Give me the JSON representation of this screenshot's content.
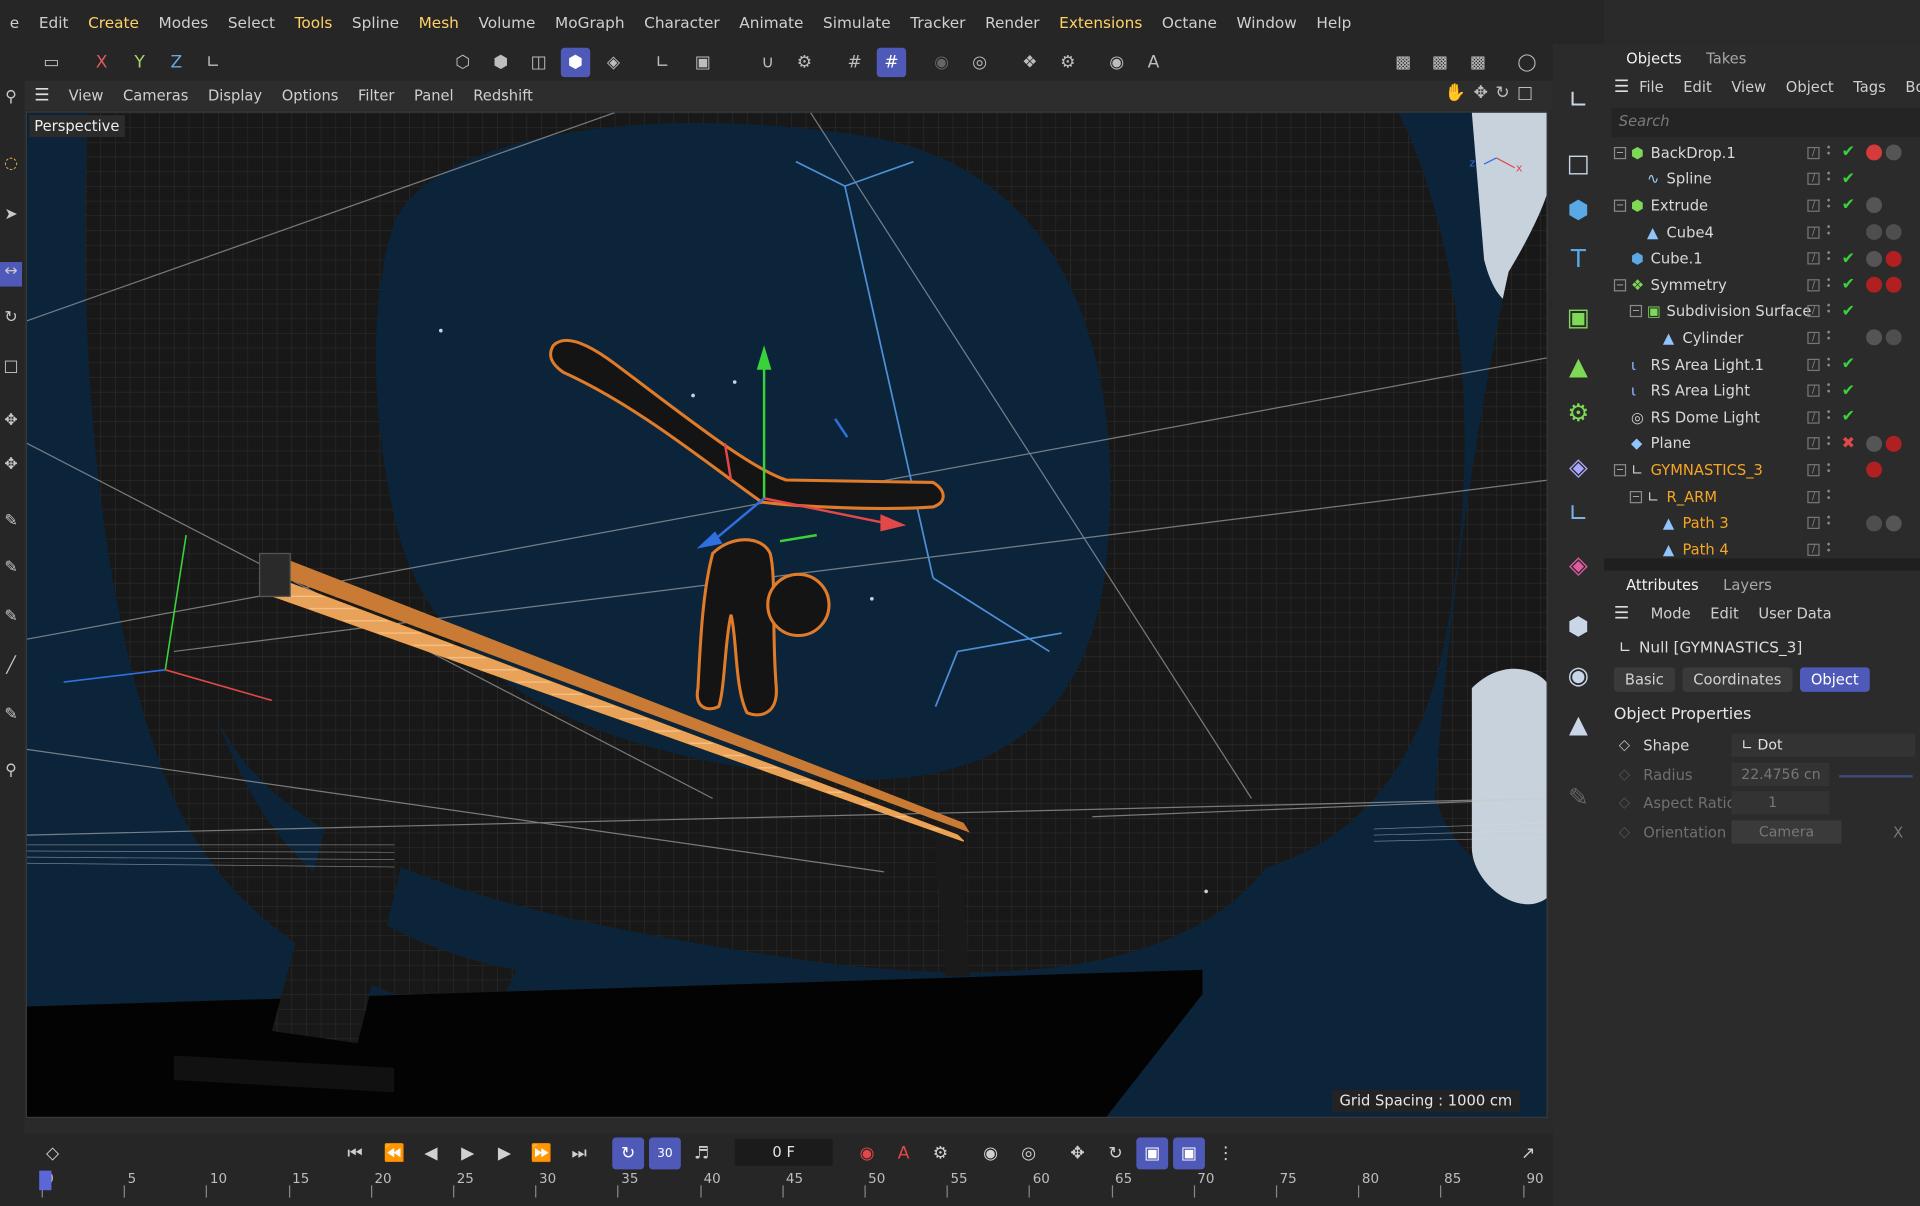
{
  "menubar": [
    "e",
    "Edit",
    "Create",
    "Modes",
    "Select",
    "Tools",
    "Spline",
    "Mesh",
    "Volume",
    "MoGraph",
    "Character",
    "Animate",
    "Simulate",
    "Tracker",
    "Render",
    "Extensions",
    "Octane",
    "Window",
    "Help"
  ],
  "highlighted_menus": [
    "Create",
    "Tools",
    "Mesh",
    "Extensions"
  ],
  "axis_buttons": {
    "x": "X",
    "y": "Y",
    "z": "Z"
  },
  "viewport_menu": [
    "View",
    "Cameras",
    "Display",
    "Options",
    "Filter",
    "Panel",
    "Redshift"
  ],
  "viewport": {
    "label": "Perspective",
    "grid_spacing": "Grid Spacing : 1000 cm",
    "bg_color": "#0c2439",
    "selection_color": "#f0a34a"
  },
  "objects_panel": {
    "tabs": [
      "Objects",
      "Takes"
    ],
    "menu": [
      "File",
      "Edit",
      "View",
      "Object",
      "Tags",
      "Book"
    ],
    "search_placeholder": "Search",
    "rows": [
      {
        "name": "BackDrop.1",
        "depth": 0,
        "icon": "cube-green",
        "expand": "-",
        "check": "check"
      },
      {
        "name": "Spline",
        "depth": 1,
        "icon": "spline",
        "expand": "",
        "check": "check"
      },
      {
        "name": "Extrude",
        "depth": 0,
        "icon": "cube-green",
        "expand": "-",
        "check": "check"
      },
      {
        "name": "Cube4",
        "depth": 1,
        "icon": "poly",
        "expand": "",
        "check": ""
      },
      {
        "name": "Cube.1",
        "depth": 0,
        "icon": "cube-blue",
        "expand": "",
        "check": "check"
      },
      {
        "name": "Symmetry",
        "depth": 0,
        "icon": "symmetry",
        "expand": "-",
        "check": "check"
      },
      {
        "name": "Subdivision Surface",
        "depth": 1,
        "icon": "subdiv",
        "expand": "-",
        "check": "check"
      },
      {
        "name": "Cylinder",
        "depth": 2,
        "icon": "poly",
        "expand": "",
        "check": ""
      },
      {
        "name": "RS Area Light.1",
        "depth": 0,
        "icon": "light",
        "expand": "",
        "check": "check"
      },
      {
        "name": "RS Area Light",
        "depth": 0,
        "icon": "light",
        "expand": "",
        "check": "check"
      },
      {
        "name": "RS Dome Light",
        "depth": 0,
        "icon": "dome",
        "expand": "",
        "check": "check"
      },
      {
        "name": "Plane",
        "depth": 0,
        "icon": "plane",
        "expand": "",
        "check": "x"
      },
      {
        "name": "GYMNASTICS_3",
        "depth": 0,
        "icon": "null",
        "expand": "-",
        "check": "",
        "orange": true
      },
      {
        "name": "R_ARM",
        "depth": 1,
        "icon": "null",
        "expand": "-",
        "check": "",
        "orange": true
      },
      {
        "name": "Path 3",
        "depth": 2,
        "icon": "poly",
        "expand": "",
        "check": "",
        "orange": true
      },
      {
        "name": "Path 4",
        "depth": 2,
        "icon": "poly",
        "expand": "",
        "check": "",
        "orange": true
      }
    ]
  },
  "attributes_panel": {
    "tabs": [
      "Attributes",
      "Layers"
    ],
    "menu": [
      "Mode",
      "Edit",
      "User Data"
    ],
    "object_name": "Null [GYMNASTICS_3]",
    "subtabs": [
      "Basic",
      "Coordinates",
      "Object"
    ],
    "active_subtab": "Object",
    "section": "Object Properties",
    "props": [
      {
        "label": "Shape",
        "value": "Dot",
        "enabled": true
      },
      {
        "label": "Radius",
        "value": "22.4756 cn",
        "enabled": false
      },
      {
        "label": "Aspect Ratio",
        "value": "1",
        "enabled": false
      },
      {
        "label": "Orientation",
        "value": "Camera",
        "enabled": false
      }
    ]
  },
  "timeline": {
    "frame": "0 F",
    "fps_label": "30",
    "ticks": [
      "0",
      "5",
      "10",
      "15",
      "20",
      "25",
      "30",
      "35",
      "40",
      "45",
      "50",
      "55",
      "60",
      "65",
      "70",
      "75",
      "80",
      "85",
      "90"
    ]
  }
}
